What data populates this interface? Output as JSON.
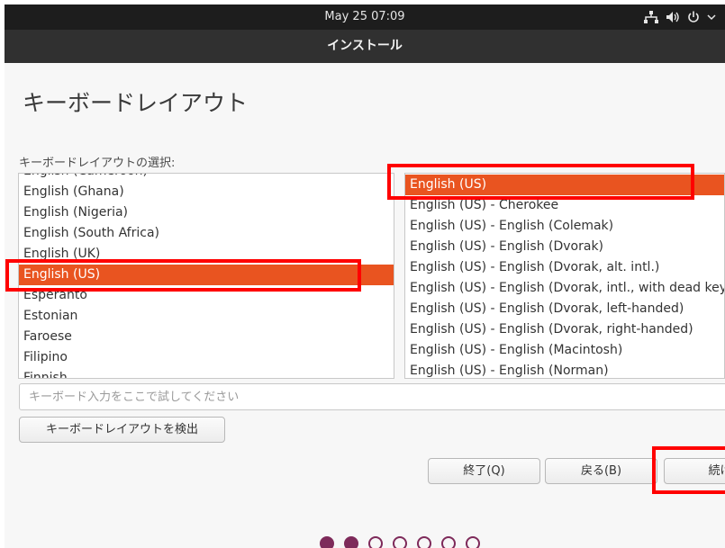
{
  "topbar": {
    "clock": "May 25  07:09",
    "icons": [
      "network-icon",
      "volume-icon",
      "power-icon",
      "chevron-down-icon"
    ]
  },
  "window": {
    "title": "インストール"
  },
  "page": {
    "heading": "キーボードレイアウト",
    "list_label": "キーボードレイアウトの選択:"
  },
  "layouts": {
    "items": [
      {
        "label": "English (Cameroon)"
      },
      {
        "label": "English (Ghana)"
      },
      {
        "label": "English (Nigeria)"
      },
      {
        "label": "English (South Africa)"
      },
      {
        "label": "English (UK)"
      },
      {
        "label": "English (US)",
        "selected": true
      },
      {
        "label": "Esperanto"
      },
      {
        "label": "Estonian"
      },
      {
        "label": "Faroese"
      },
      {
        "label": "Filipino"
      },
      {
        "label": "Finnish"
      }
    ]
  },
  "variants": {
    "items": [
      {
        "label": "English (US)",
        "selected": true
      },
      {
        "label": "English (US) - Cherokee"
      },
      {
        "label": "English (US) - English (Colemak)"
      },
      {
        "label": "English (US) - English (Dvorak)"
      },
      {
        "label": "English (US) - English (Dvorak, alt. intl.)"
      },
      {
        "label": "English (US) - English (Dvorak, intl., with dead keys)"
      },
      {
        "label": "English (US) - English (Dvorak, left-handed)"
      },
      {
        "label": "English (US) - English (Dvorak, right-handed)"
      },
      {
        "label": "English (US) - English (Macintosh)"
      },
      {
        "label": "English (US) - English (Norman)"
      }
    ]
  },
  "test_input": {
    "placeholder": "キーボード入力をここで試してください",
    "value": ""
  },
  "buttons": {
    "detect": "キーボードレイアウトを検出",
    "quit": "終了(Q)",
    "back": "戻る(B)",
    "continue": "続け"
  },
  "progress": {
    "total": 7,
    "done": 2
  },
  "colors": {
    "accent": "#e95420",
    "topbar": "#1d1d1d",
    "titlebar": "#303030",
    "dot": "#7e2a5a",
    "annotation": "#ff0000"
  }
}
